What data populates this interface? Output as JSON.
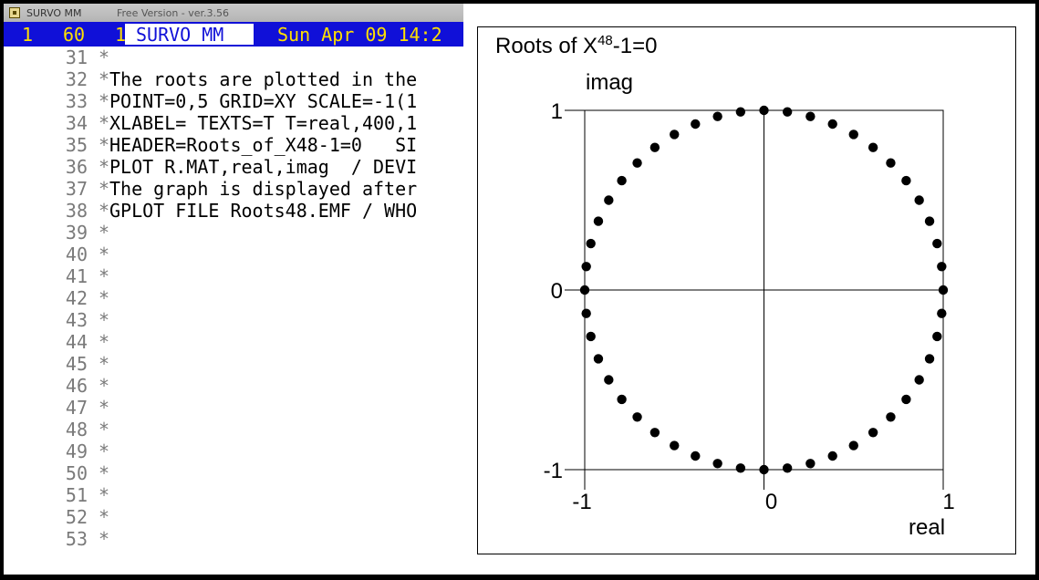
{
  "window": {
    "app_name": "SURVO MM",
    "version_text": "Free Version  -  ver.3.56"
  },
  "status": {
    "line": "1",
    "column": "60",
    "mode": "1",
    "name": "SURVO MM",
    "datetime": "Sun Apr 09 14:2"
  },
  "editor": {
    "lines": [
      {
        "num": "31",
        "ctrl": "*",
        "text": ""
      },
      {
        "num": "32",
        "ctrl": "*",
        "text": "The roots are plotted in the"
      },
      {
        "num": "33",
        "ctrl": "*",
        "text": "POINT=0,5 GRID=XY SCALE=-1(1"
      },
      {
        "num": "34",
        "ctrl": "*",
        "text": "XLABEL= TEXTS=T T=real,400,1"
      },
      {
        "num": "35",
        "ctrl": "*",
        "text": "HEADER=Roots_of_X48-1=0   SI"
      },
      {
        "num": "36",
        "ctrl": "*",
        "text": "PLOT R.MAT,real,imag  / DEVI"
      },
      {
        "num": "37",
        "ctrl": "*",
        "text": "The graph is displayed after"
      },
      {
        "num": "38",
        "ctrl": "*",
        "text": "GPLOT FILE Roots48.EMF / WHO"
      },
      {
        "num": "39",
        "ctrl": "*",
        "text": ""
      },
      {
        "num": "40",
        "ctrl": "*",
        "text": ""
      },
      {
        "num": "41",
        "ctrl": "*",
        "text": ""
      },
      {
        "num": "42",
        "ctrl": "*",
        "text": ""
      },
      {
        "num": "43",
        "ctrl": "*",
        "text": ""
      },
      {
        "num": "44",
        "ctrl": "*",
        "text": ""
      },
      {
        "num": "45",
        "ctrl": "*",
        "text": ""
      },
      {
        "num": "46",
        "ctrl": "*",
        "text": ""
      },
      {
        "num": "47",
        "ctrl": "*",
        "text": ""
      },
      {
        "num": "48",
        "ctrl": "*",
        "text": ""
      },
      {
        "num": "49",
        "ctrl": "*",
        "text": ""
      },
      {
        "num": "50",
        "ctrl": "*",
        "text": ""
      },
      {
        "num": "51",
        "ctrl": "*",
        "text": ""
      },
      {
        "num": "52",
        "ctrl": "*",
        "text": ""
      },
      {
        "num": "53",
        "ctrl": "*",
        "text": ""
      }
    ]
  },
  "chart_data": {
    "type": "scatter",
    "title_base": "Roots of X",
    "title_sup": "48",
    "title_rest": "-1=0",
    "xlabel": "real",
    "ylabel": "imag",
    "xlim": [
      -1,
      1
    ],
    "ylim": [
      -1,
      1
    ],
    "x_ticks": [
      "-1",
      "0",
      "1"
    ],
    "y_ticks": [
      "1",
      "0",
      "-1"
    ],
    "grid": "XY",
    "point_count": 48,
    "point_formula": "x=cos(2*pi*k/48), y=sin(2*pi*k/48), k=0..47"
  }
}
